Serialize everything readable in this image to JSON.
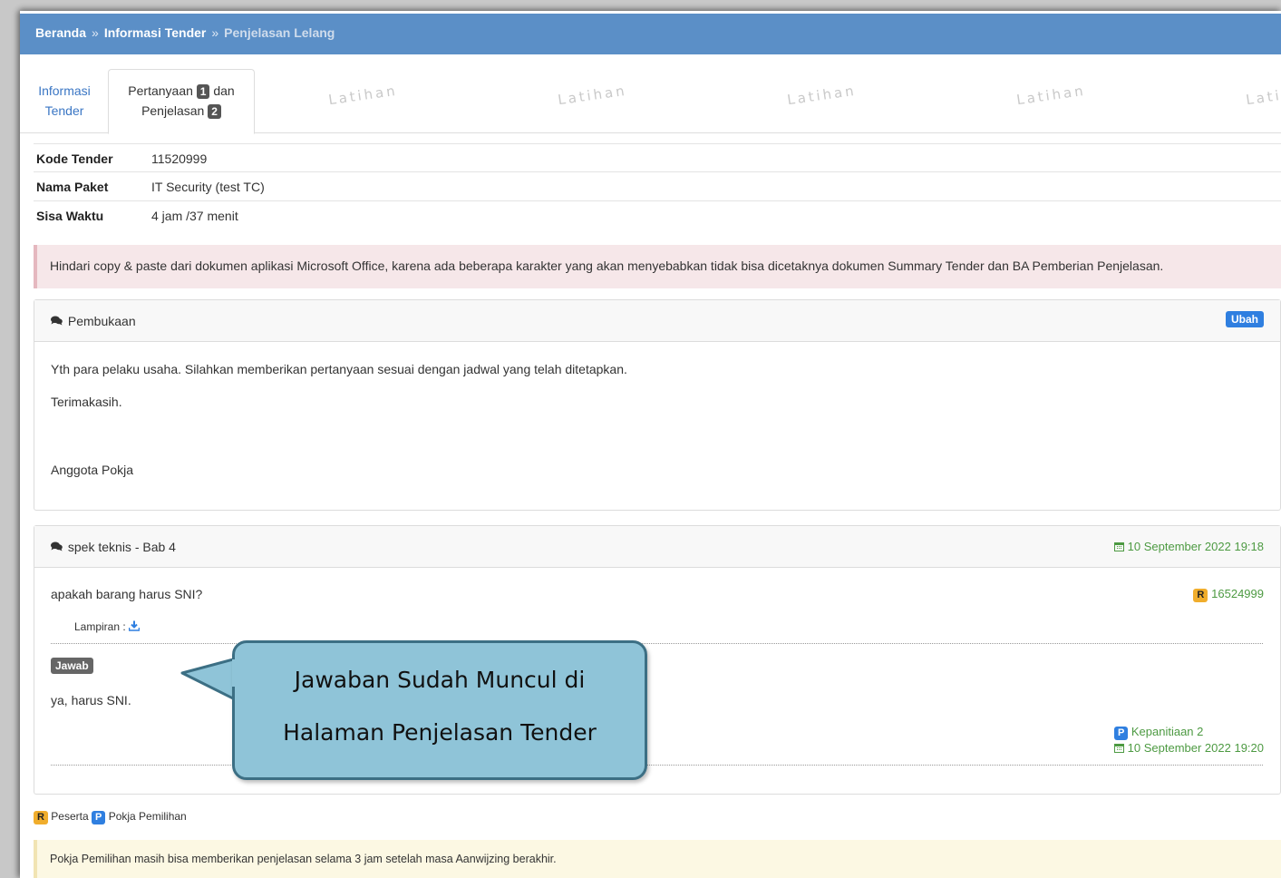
{
  "breadcrumb": {
    "home": "Beranda",
    "sep": "»",
    "info": "Informasi Tender",
    "current": "Penjelasan Lelang"
  },
  "tabs": {
    "info_line1": "Informasi",
    "info_line2": "Tender",
    "qa_line1_a": "Pertanyaan",
    "qa_badge1": "1",
    "qa_line1_b": "dan",
    "qa_line2": "Penjelasan",
    "qa_badge2": "2"
  },
  "watermark": "Latihan",
  "tender_info": {
    "kode_label": "Kode Tender",
    "kode_value": "11520999",
    "nama_label": "Nama Paket",
    "nama_value": "IT Security (test TC)",
    "sisa_label": "Sisa Waktu",
    "sisa_value": "4 jam /37 menit"
  },
  "alert_danger": "Hindari copy & paste dari dokumen aplikasi Microsoft Office, karena ada beberapa karakter yang akan menyebabkan tidak bisa dicetaknya dokumen Summary Tender dan BA Pemberian Penjelasan.",
  "pembukaan": {
    "title": "Pembukaan",
    "edit_label": "Ubah",
    "line1": "Yth para pelaku usaha. Silahkan memberikan pertanyaan sesuai dengan jadwal yang telah ditetapkan.",
    "line2": "Terimakasih.",
    "line3": "Anggota Pokja"
  },
  "question": {
    "title": "spek teknis - Bab 4",
    "date": "10 September 2022 19:18",
    "text": "apakah barang harus SNI?",
    "user_badge": "R",
    "user_id": "16524999",
    "attachment_label": "Lampiran :",
    "answer_badge": "Jawab",
    "answer_text": "ya, harus SNI.",
    "answer_badge_p": "P",
    "answer_user": "Kepanitiaan 2",
    "answer_date": "10 September 2022 19:20"
  },
  "legend": {
    "r_badge": "R",
    "r_label": "Peserta",
    "p_badge": "P",
    "p_label": "Pokja Pemilihan"
  },
  "alert_warning": "Pokja Pemilihan masih bisa memberikan penjelasan selama 3 jam setelah masa Aanwijzing berakhir.",
  "callout": {
    "line1": "Jawaban Sudah Muncul di",
    "line2": "Halaman Penjelasan Tender"
  },
  "colors": {
    "header_blue": "#5b8fc7",
    "badge_blue": "#2f7fe0",
    "badge_orange": "#f0ad2c",
    "date_green": "#4d9a42",
    "callout_fill": "#8fc4d8"
  }
}
